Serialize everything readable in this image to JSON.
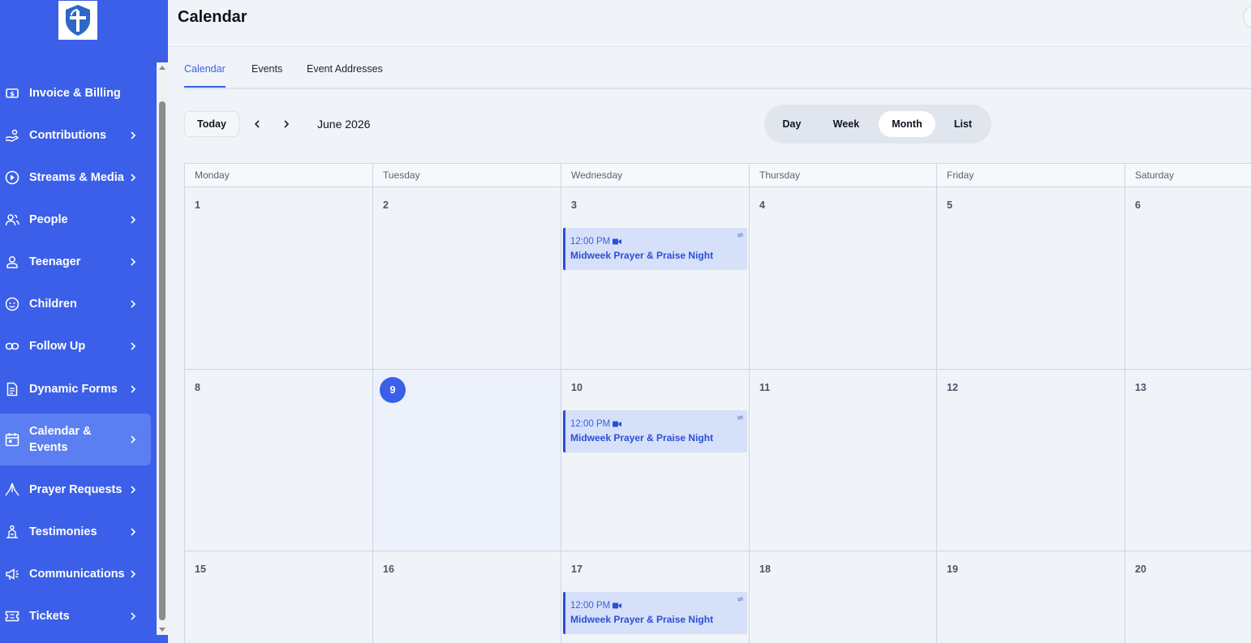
{
  "header": {
    "title": "Calendar"
  },
  "tabs": [
    {
      "label": "Calendar",
      "active": true
    },
    {
      "label": "Events",
      "active": false
    },
    {
      "label": "Event Addresses",
      "active": false
    }
  ],
  "toolbar": {
    "today_label": "Today",
    "month_label": "June 2026",
    "views": [
      "Day",
      "Week",
      "Month",
      "List"
    ],
    "active_view": "Month"
  },
  "sidebar": {
    "items": [
      {
        "label": "Invoice & Billing",
        "icon": "invoice-icon",
        "has_chevron": false
      },
      {
        "label": "Contributions",
        "icon": "hand-coins-icon",
        "has_chevron": true
      },
      {
        "label": "Streams & Media",
        "icon": "play-circle-icon",
        "has_chevron": true
      },
      {
        "label": "People",
        "icon": "users-icon",
        "has_chevron": true
      },
      {
        "label": "Teenager",
        "icon": "user-icon",
        "has_chevron": true
      },
      {
        "label": "Children",
        "icon": "smile-icon",
        "has_chevron": true
      },
      {
        "label": "Follow Up",
        "icon": "link-icon",
        "has_chevron": true
      },
      {
        "label": "Dynamic Forms",
        "icon": "form-icon",
        "has_chevron": true
      },
      {
        "label": "Calendar & Events",
        "icon": "calendar-icon",
        "has_chevron": true,
        "active": true
      },
      {
        "label": "Prayer Requests",
        "icon": "praying-hands-icon",
        "has_chevron": true
      },
      {
        "label": "Testimonies",
        "icon": "testimony-icon",
        "has_chevron": true
      },
      {
        "label": "Communications",
        "icon": "megaphone-icon",
        "has_chevron": true
      },
      {
        "label": "Tickets",
        "icon": "ticket-icon",
        "has_chevron": true
      }
    ]
  },
  "calendar": {
    "weekdays": [
      "Monday",
      "Tuesday",
      "Wednesday",
      "Thursday",
      "Friday",
      "Saturday"
    ],
    "weeks": [
      [
        "1",
        "2",
        "3",
        "4",
        "5",
        "6"
      ],
      [
        "8",
        "9",
        "10",
        "11",
        "12",
        "13"
      ],
      [
        "15",
        "16",
        "17",
        "18",
        "19",
        "20"
      ]
    ],
    "today": "9",
    "events": [
      {
        "day": "3",
        "time": "12:00 PM",
        "title": "Midweek Prayer & Praise Night"
      },
      {
        "day": "10",
        "time": "12:00 PM",
        "title": "Midweek Prayer & Praise Night"
      },
      {
        "day": "17",
        "time": "12:00 PM",
        "title": "Midweek Prayer & Praise Night"
      }
    ]
  },
  "colors": {
    "sidebar_bg": "#3b5fe8",
    "sidebar_active": "#5b7ef0",
    "accent": "#3b5fe8",
    "event_bg": "#d6e0f8"
  }
}
